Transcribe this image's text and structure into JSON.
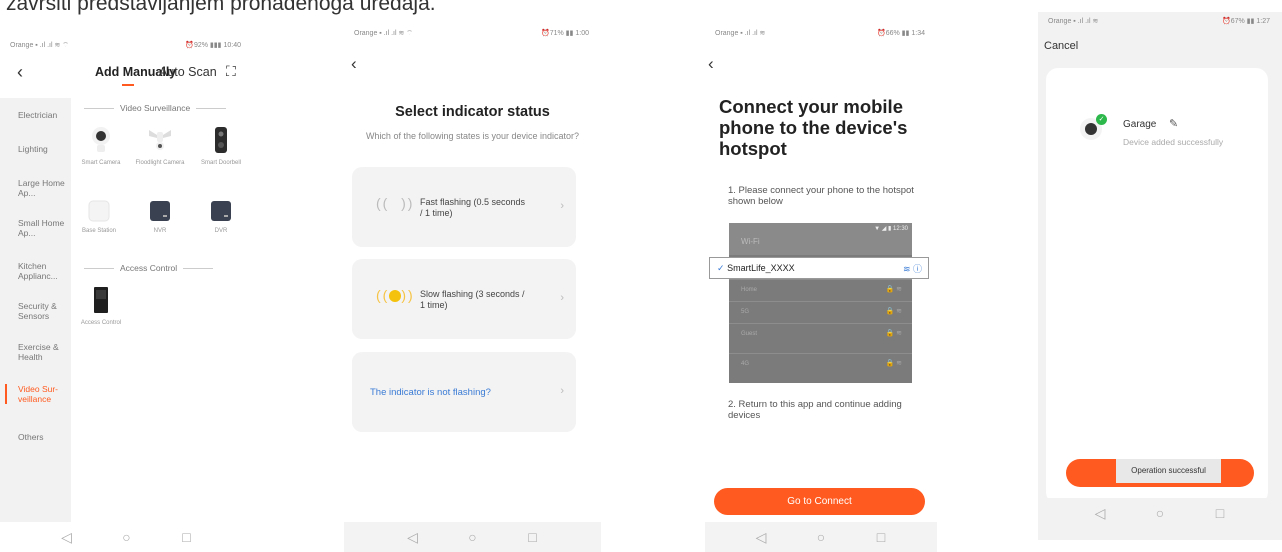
{
  "doc": {
    "text": "završiti predstavljanjem pronađenoga uređaja."
  },
  "phone1": {
    "status_left": "Orange ▪ .ıl .ıl ≋ ⌔",
    "status_right": "⏰92% ▮▮▮ 10:40",
    "tab_add": "Add Manually",
    "tab_auto": "Auto Scan",
    "sidebar": [
      "Electrician",
      "Lighting",
      "Large Home Ap...",
      "Small Home Ap...",
      "Kitchen Applianc...",
      "Security & Sensors",
      "Exercise & Health",
      "Video Sur-veillance",
      "Others"
    ],
    "section_video": "Video Surveillance",
    "section_access": "Access Control",
    "devices": [
      "Smart Camera",
      "Floodlight Camera",
      "Smart Doorbell",
      "Base Station",
      "NVR",
      "DVR",
      "Access Control"
    ]
  },
  "phone2": {
    "status_left": "Orange ▪ .ıl .ıl ≋ ⌔",
    "status_right": "⏰71% ▮▮ 1:00",
    "title": "Select indicator status",
    "subtitle": "Which of the following states is your device indicator?",
    "option_fast": "Fast flashing (0.5 seconds / 1 time)",
    "option_slow": "Slow flashing (3 seconds / 1 time)",
    "not_flashing": "The indicator is not flashing?"
  },
  "phone3": {
    "status_left": "Orange ▪ .ıl .ıl ≋",
    "status_right": "⏰66% ▮▮ 1:34",
    "title": "Connect your mobile phone to the device's hotspot",
    "step1": "1. Please connect your phone to the hotspot shown below",
    "wifi_label": "Wi-Fi",
    "wifi_status": "▼ ◢ ▮ 12:30",
    "network_selected": "SmartLife_XXXX",
    "networks": [
      "Home",
      "5G",
      "Guest",
      "4G"
    ],
    "step2": "2. Return to this app and continue adding devices",
    "button": "Go to Connect"
  },
  "phone4": {
    "status_left": "Orange ▪ .ıl .ıl ≋",
    "status_right": "⏰67% ▮▮ 1:27",
    "cancel": "Cancel",
    "device_name": "Garage",
    "device_status": "Device added successfully",
    "toast": "Operation successful"
  },
  "colors": {
    "accent": "#ff5a1f",
    "link": "#3a7bd5",
    "success": "#2db84b"
  },
  "icons": {
    "back": "chevron-left-icon",
    "scan": "scan-icon",
    "nav_back": "triangle-back-icon",
    "nav_home": "circle-home-icon",
    "nav_recent": "square-recent-icon"
  }
}
